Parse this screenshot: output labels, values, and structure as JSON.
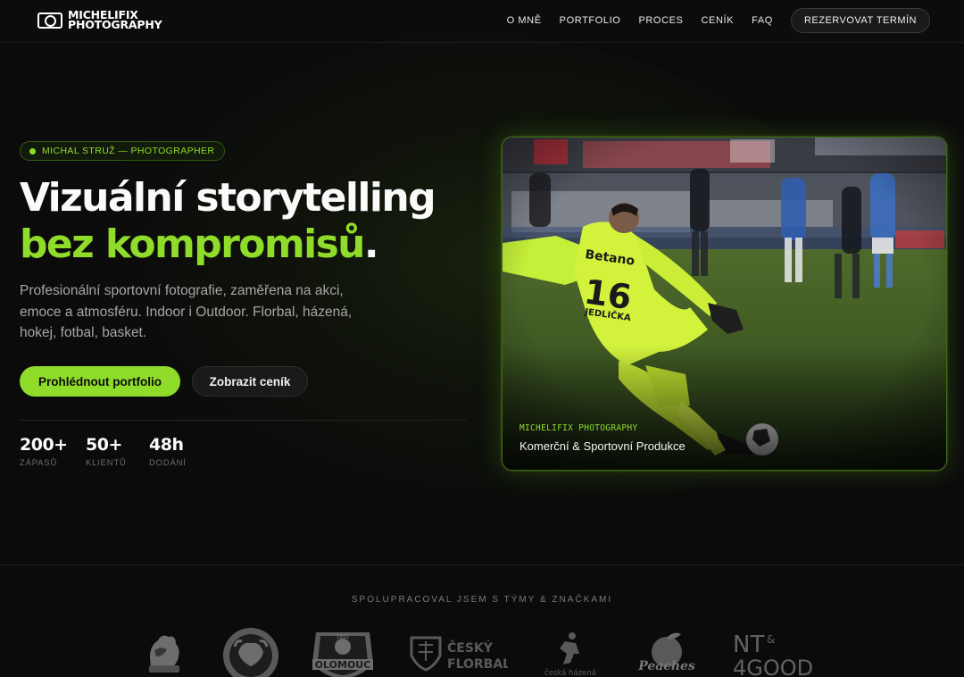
{
  "header": {
    "logo_line1": "MICHELIFIX",
    "logo_line2": "PHOTOGRAPHY",
    "nav": [
      "O MNĚ",
      "PORTFOLIO",
      "PROCES",
      "CENÍK",
      "FAQ"
    ],
    "cta": "REZERVOVAT TERMÍN"
  },
  "hero": {
    "badge": "MICHAL STRUŽ — PHOTOGRAPHER",
    "title_line1": "Vizuální storytelling",
    "title_accent": "bez kompromisů",
    "title_period": ".",
    "subtitle": "Profesionální sportovní fotografie, zaměřena na akci, emoce a atmosféru. Indoor i Outdoor. Florbal, házená, hokej, fotbal, basket.",
    "primary_button": "Prohlédnout portfolio",
    "secondary_button": "Zobrazit ceník",
    "stats": [
      {
        "value": "200+",
        "label": "ZÁPASŮ"
      },
      {
        "value": "50+",
        "label": "KLIENTŮ"
      },
      {
        "value": "48h",
        "label": "DODÁNÍ"
      }
    ]
  },
  "card": {
    "kicker": "MICHELIFIX PHOTOGRAPHY",
    "caption": "Komerční & Sportovní Produkce",
    "jersey_sponsor": "Betano",
    "jersey_number": "16",
    "jersey_name": "JEDLIČKA"
  },
  "partners": {
    "title": "SPOLUPRACOVAL JSEM S TÝMY & ZNAČKAMI",
    "logos": [
      {
        "name": "team-rooster-logo"
      },
      {
        "name": "bison-club-logo"
      },
      {
        "name": "olomouc-logo",
        "text": "OLOMOUC",
        "year": "1951"
      },
      {
        "name": "cesky-florbal-logo",
        "text1": "ČESKÝ",
        "text2": "FLORBAL"
      },
      {
        "name": "ceska-hazena-logo",
        "text": "česká házená"
      },
      {
        "name": "peaches-logo",
        "text": "Peaches"
      },
      {
        "name": "nt4good-logo",
        "text1": "NT",
        "text2": "&",
        "text3": "4GOOD"
      }
    ]
  },
  "colors": {
    "accent": "#8fdc2a",
    "background": "#0b0b0b"
  }
}
